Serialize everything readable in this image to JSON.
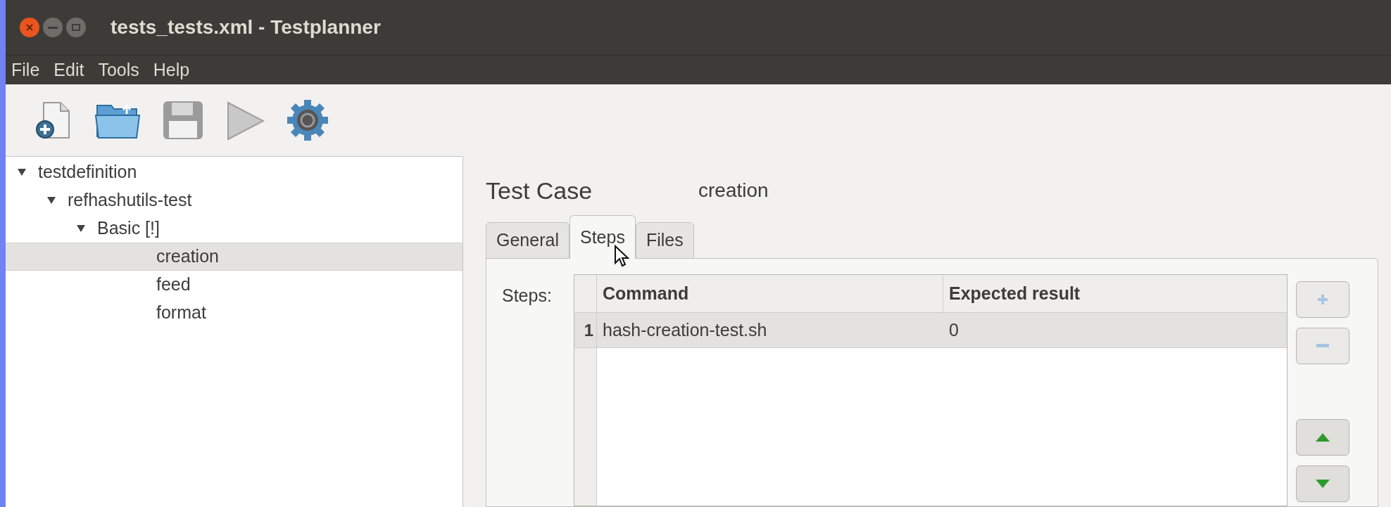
{
  "window": {
    "title": "tests_tests.xml - Testplanner"
  },
  "menu": [
    "File",
    "Edit",
    "Tools",
    "Help"
  ],
  "toolbar": [
    {
      "kind": "new"
    },
    {
      "kind": "open"
    },
    {
      "kind": "save"
    },
    {
      "kind": "run"
    },
    {
      "kind": "settings"
    }
  ],
  "tree": [
    {
      "label": "testdefinition",
      "expanded": true,
      "selected": false,
      "children": [
        {
          "label": "refhashutils-test",
          "expanded": true,
          "selected": false,
          "children": [
            {
              "label": "Basic [!]",
              "expanded": true,
              "selected": false,
              "children": [
                {
                  "label": "creation",
                  "selected": true
                },
                {
                  "label": "feed",
                  "selected": false
                },
                {
                  "label": "format",
                  "selected": false
                }
              ]
            }
          ]
        }
      ]
    }
  ],
  "heading": {
    "label": "Test Case",
    "value": "creation"
  },
  "tabs": [
    {
      "label": "General",
      "selected": false
    },
    {
      "label": "Steps",
      "selected": true
    },
    {
      "label": "Files",
      "selected": false
    }
  ],
  "steps_label": "Steps:",
  "table": {
    "columns": [
      "Command",
      "Expected result"
    ],
    "rows": [
      {
        "number": "1",
        "cells": [
          "hash-creation-test.sh",
          "0"
        ],
        "selected": true
      }
    ]
  },
  "side_buttons": [
    {
      "kind": "add",
      "disabled": true
    },
    {
      "kind": "remove",
      "disabled": true
    },
    {
      "kind": "up",
      "disabled": false
    },
    {
      "kind": "down",
      "disabled": false
    }
  ]
}
